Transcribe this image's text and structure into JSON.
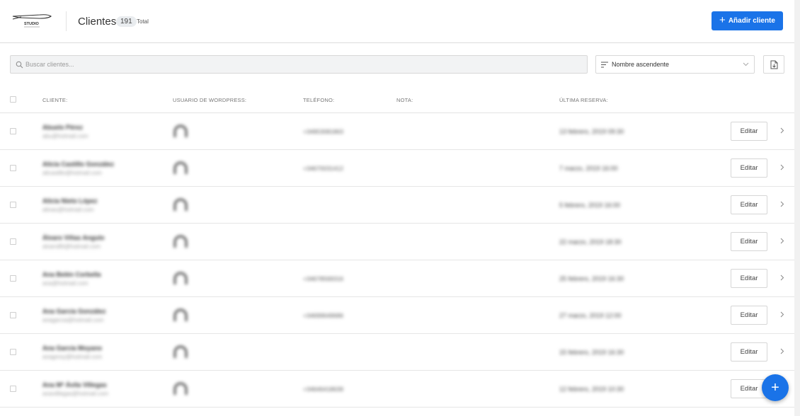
{
  "header": {
    "logo_text": "STUDIO",
    "title": "Clientes",
    "count": "191",
    "count_suffix": "Total",
    "add_button": "Añadir cliente"
  },
  "toolbar": {
    "search_placeholder": "Buscar clientes...",
    "sort_label": "Nombre ascendente"
  },
  "table": {
    "columns": [
      "CLIENTE:",
      "USUARIO DE WORDPRESS:",
      "TELÉFONO:",
      "NOTA:",
      "ÚLTIMA RESERVA:"
    ],
    "edit_label": "Editar",
    "rows": [
      {
        "name": "Abuelo Pérez",
        "email": "abu@hotmail.com",
        "phone": "+34953081863",
        "reservation": "13 febrero, 2019 09:30"
      },
      {
        "name": "Alicia Castillo González",
        "email": "alicastillo@hotmail.com",
        "phone": "+34670031412",
        "reservation": "7 marzo, 2019 16:00"
      },
      {
        "name": "Alicia Nieto López",
        "email": "alinao@hotmail.com",
        "phone": "",
        "reservation": "5 febrero, 2019 16:00"
      },
      {
        "name": "Álvaro Viñas Angulo",
        "email": "alvaro86@hotmail.com",
        "phone": "",
        "reservation": "22 marzo, 2019 18:30"
      },
      {
        "name": "Ana Belén Corbella",
        "email": "ana@hotmail.com",
        "phone": "+34678569316",
        "reservation": "25 febrero, 2019 16:30"
      },
      {
        "name": "Ana García González",
        "email": "anagarcia@hotmail.com",
        "phone": "+34699649686",
        "reservation": "27 marzo, 2019 12:00"
      },
      {
        "name": "Ana García Moyano",
        "email": "anagmoy@hotmail.com",
        "phone": "",
        "reservation": "15 febrero, 2019 16:30"
      },
      {
        "name": "Ana Mª Ávila Villegas",
        "email": "anaviillegas@hotmail.com",
        "phone": "+34646418639",
        "reservation": "12 febrero, 2019 10:30"
      }
    ]
  },
  "fab_label": "+"
}
